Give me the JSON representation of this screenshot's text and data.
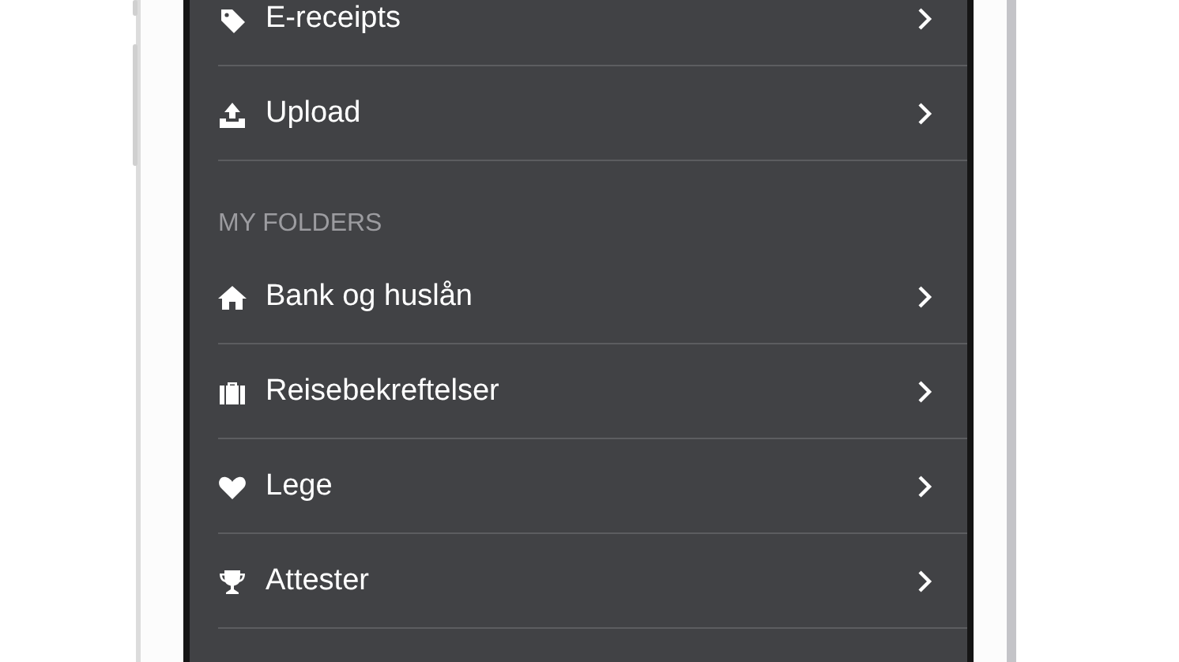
{
  "menu": {
    "items": [
      {
        "label": "E-receipts"
      },
      {
        "label": "Upload"
      }
    ]
  },
  "folders": {
    "header": "MY FOLDERS",
    "items": [
      {
        "label": "Bank og huslån"
      },
      {
        "label": "Reisebekreftelser"
      },
      {
        "label": "Lege"
      },
      {
        "label": "Attester"
      }
    ]
  }
}
